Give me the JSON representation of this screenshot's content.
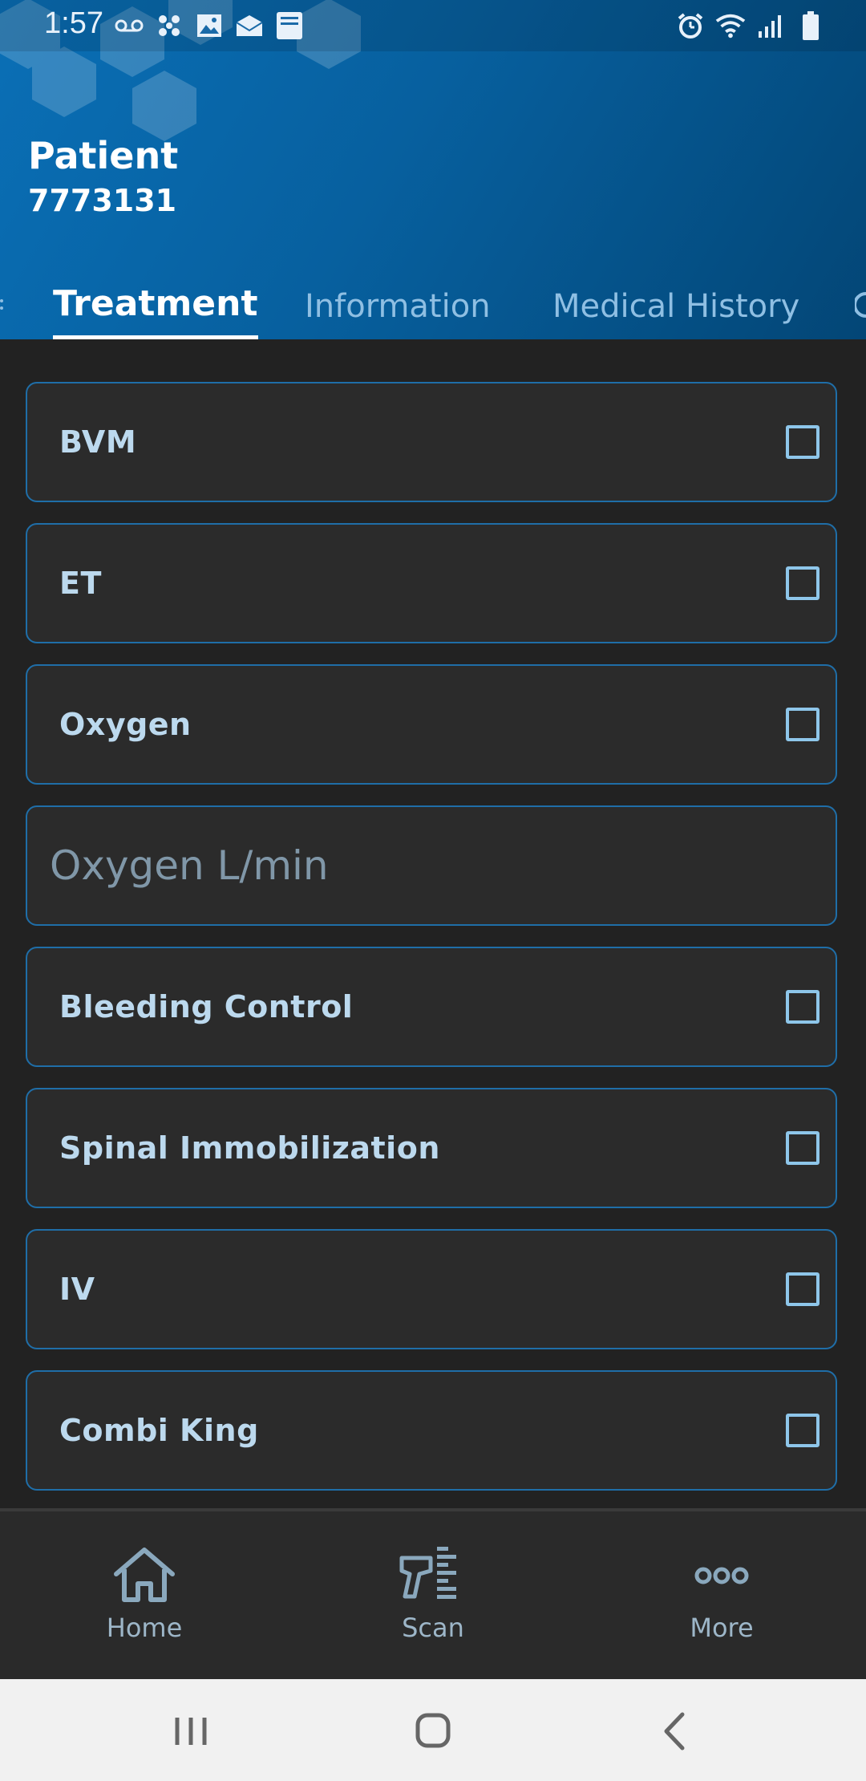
{
  "status_bar": {
    "time": "1:57"
  },
  "header": {
    "title": "Patient",
    "patient_id": "7773131"
  },
  "tabs": [
    {
      "label": "Treatment",
      "active": true
    },
    {
      "label": "Information",
      "active": false
    },
    {
      "label": "Medical History",
      "active": false
    }
  ],
  "treatments": [
    {
      "label": "BVM",
      "checked": false
    },
    {
      "label": "ET",
      "checked": false
    },
    {
      "label": "Oxygen",
      "checked": false
    },
    {
      "label": "Bleeding Control",
      "checked": false
    },
    {
      "label": "Spinal Immobilization",
      "checked": false
    },
    {
      "label": "IV",
      "checked": false
    },
    {
      "label": "Combi King",
      "checked": false
    }
  ],
  "oxygen_field": {
    "placeholder": "Oxygen L/min",
    "value": ""
  },
  "bottom_nav": {
    "home": {
      "label": "Home",
      "icon": "home-icon"
    },
    "scan": {
      "label": "Scan",
      "icon": "barcode-scanner-icon"
    },
    "more": {
      "label": "More",
      "icon": "more-dots-icon"
    }
  },
  "colors": {
    "header_gradient_start": "#0a6fb6",
    "header_gradient_end": "#034676",
    "row_border": "#1f6ea8",
    "checkbox": "#8ec6ea",
    "background": "#222222"
  }
}
